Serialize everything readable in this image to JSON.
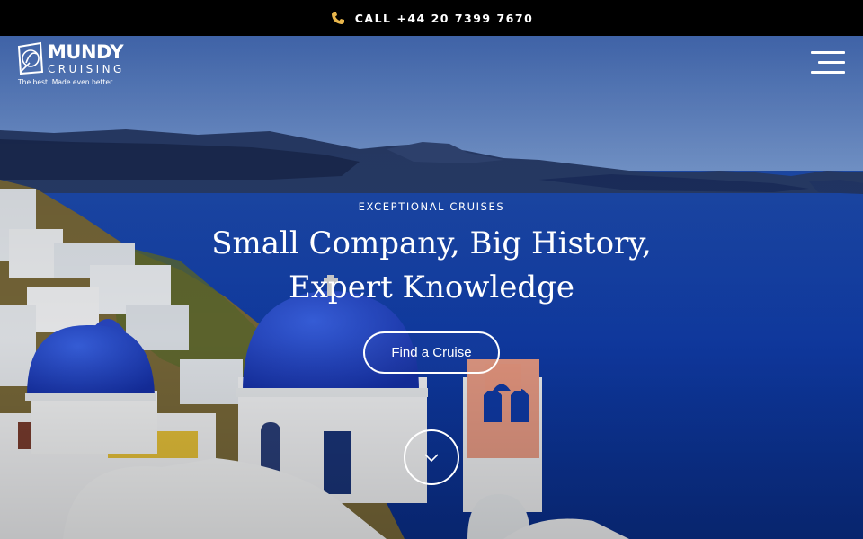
{
  "topbar": {
    "call_text": "CALL +44 20 7399 7670",
    "icon": "phone-icon"
  },
  "brand": {
    "name": "MUNDY",
    "sub": "CRUISING",
    "tagline": "The best. Made even better."
  },
  "nav": {
    "menu_icon": "hamburger-menu-icon"
  },
  "hero": {
    "eyebrow": "EXCEPTIONAL CRUISES",
    "headline": "Small Company, Big History, Expert Knowledge",
    "cta_label": "Find a Cruise",
    "scroll_icon": "chevron-down-icon"
  },
  "colors": {
    "topbar": "#000000",
    "sea": "#0d3fae",
    "dome": "#1b3fc9",
    "accent_icon": "#e8b64c"
  }
}
